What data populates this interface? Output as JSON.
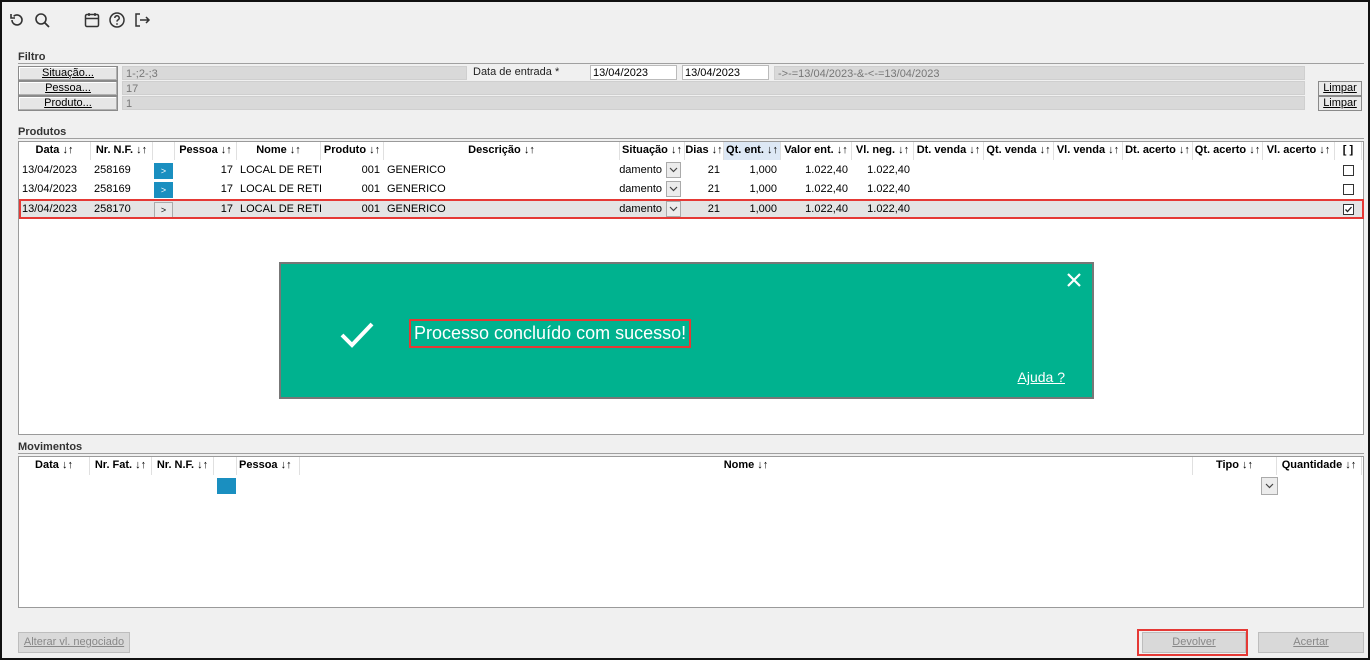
{
  "toolbar": {
    "icons": [
      "refresh-icon",
      "search-icon",
      "calendar-icon",
      "help-icon",
      "exit-icon"
    ]
  },
  "filtro": {
    "title": "Filtro",
    "situacao": {
      "label": "Situação...",
      "value": "1-;2-;3"
    },
    "pessoa": {
      "label": "Pessoa...",
      "value": "17"
    },
    "produto": {
      "label": "Produto...",
      "value": "1"
    },
    "data_entrada": {
      "label": "Data de entrada *",
      "from": "13/04/2023",
      "to": "13/04/2023",
      "expression": "->-=13/04/2023-&-<-=13/04/2023"
    },
    "limpar_label": "Limpar"
  },
  "produtos": {
    "title": "Produtos",
    "columns": [
      "Data ↓↑",
      "Nr. N.F. ↓↑",
      "",
      "Pessoa ↓↑",
      "Nome ↓↑",
      "Produto ↓↑",
      "Descrição ↓↑",
      "Situação ↓↑",
      "Dias ↓↑",
      "Qt. ent. ↓↑",
      "Valor ent. ↓↑",
      "Vl. neg. ↓↑",
      "Dt. venda ↓↑",
      "Qt. venda ↓↑",
      "Vl. venda ↓↑",
      "Dt. acerto ↓↑",
      "Qt. acerto ↓↑",
      "Vl. acerto ↓↑",
      "[ ]"
    ],
    "rows": [
      {
        "data": "13/04/2023",
        "nf": "258169",
        "btn": ">",
        "pessoa": "17",
        "nome": "LOCAL DE RETIR",
        "produto": "001",
        "descricao": "GENERICO",
        "situacao": "damento",
        "dias": "21",
        "qt_ent": "1,000",
        "valor_ent": "1.022,40",
        "vl_neg": "1.022,40",
        "checked": false
      },
      {
        "data": "13/04/2023",
        "nf": "258169",
        "btn": ">",
        "pessoa": "17",
        "nome": "LOCAL DE RETIR",
        "produto": "001",
        "descricao": "GENERICO",
        "situacao": "damento",
        "dias": "21",
        "qt_ent": "1,000",
        "valor_ent": "1.022,40",
        "vl_neg": "1.022,40",
        "checked": false
      },
      {
        "data": "13/04/2023",
        "nf": "258170",
        "btn": ">",
        "pessoa": "17",
        "nome": "LOCAL DE RETIR",
        "produto": "001",
        "descricao": "GENERICO",
        "situacao": "damento",
        "dias": "21",
        "qt_ent": "1,000",
        "valor_ent": "1.022,40",
        "vl_neg": "1.022,40",
        "checked": true
      }
    ]
  },
  "toast": {
    "message": "Processo concluído com sucesso!",
    "help": "Ajuda ?",
    "color": "#00b28f"
  },
  "movimentos": {
    "title": "Movimentos",
    "columns": [
      "Data ↓↑",
      "Nr. Fat. ↓↑",
      "Nr. N.F. ↓↑",
      "",
      "Pessoa ↓↑",
      "Nome ↓↑",
      "Tipo ↓↑",
      "Quantidade ↓↑"
    ]
  },
  "footer": {
    "alterar": "Alterar vl. negociado",
    "devolver": "Devolver",
    "acertar": "Acertar"
  },
  "colors": {
    "accent_blue": "#1a8fc0",
    "highlight_red": "#e53935"
  }
}
